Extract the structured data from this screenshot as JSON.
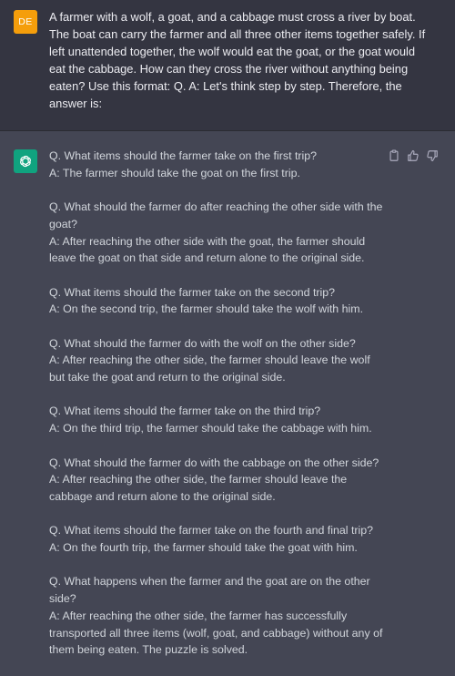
{
  "user_message": {
    "avatar_initials": "DE",
    "text": "A farmer with a wolf, a goat, and a cabbage must cross a river by boat. The boat can carry the farmer and all three other items together safely. If left unattended together, the wolf would eat the goat, or the goat would eat the cabbage. How can they cross the river without anything being eaten? Use this format: Q. A: Let's think step by step. Therefore, the answer is:"
  },
  "assistant_message": {
    "icons": [
      "openai-logo-icon",
      "copy-icon",
      "thumbs-up-icon",
      "thumbs-down-icon"
    ],
    "qa": [
      {
        "q": "Q. What items should the farmer take on the first trip?",
        "a": "A: The farmer should take the goat on the first trip."
      },
      {
        "q": "Q. What should the farmer do after reaching the other side with the goat?",
        "a": "A: After reaching the other side with the goat, the farmer should leave the goat on that side and return alone to the original side."
      },
      {
        "q": "Q. What items should the farmer take on the second trip?",
        "a": "A: On the second trip, the farmer should take the wolf with him."
      },
      {
        "q": "Q. What should the farmer do with the wolf on the other side?",
        "a": "A: After reaching the other side, the farmer should leave the wolf but take the goat and return to the original side."
      },
      {
        "q": "Q. What items should the farmer take on the third trip?",
        "a": "A: On the third trip, the farmer should take the cabbage with him."
      },
      {
        "q": "Q. What should the farmer do with the cabbage on the other side?",
        "a": "A: After reaching the other side, the farmer should leave the cabbage and return alone to the original side."
      },
      {
        "q": "Q. What items should the farmer take on the fourth and final trip?",
        "a": "A: On the fourth trip, the farmer should take the goat with him."
      },
      {
        "q": "Q. What happens when the farmer and the goat are on the other side?",
        "a": "A: After reaching the other side, the farmer has successfully transported all three items (wolf, goat, and cabbage) without any of them being eaten. The puzzle is solved."
      }
    ]
  },
  "colors": {
    "user_bg": "#343541",
    "assistant_bg": "#444654",
    "user_avatar": "#f59e0b",
    "bot_avatar": "#10a37f"
  }
}
